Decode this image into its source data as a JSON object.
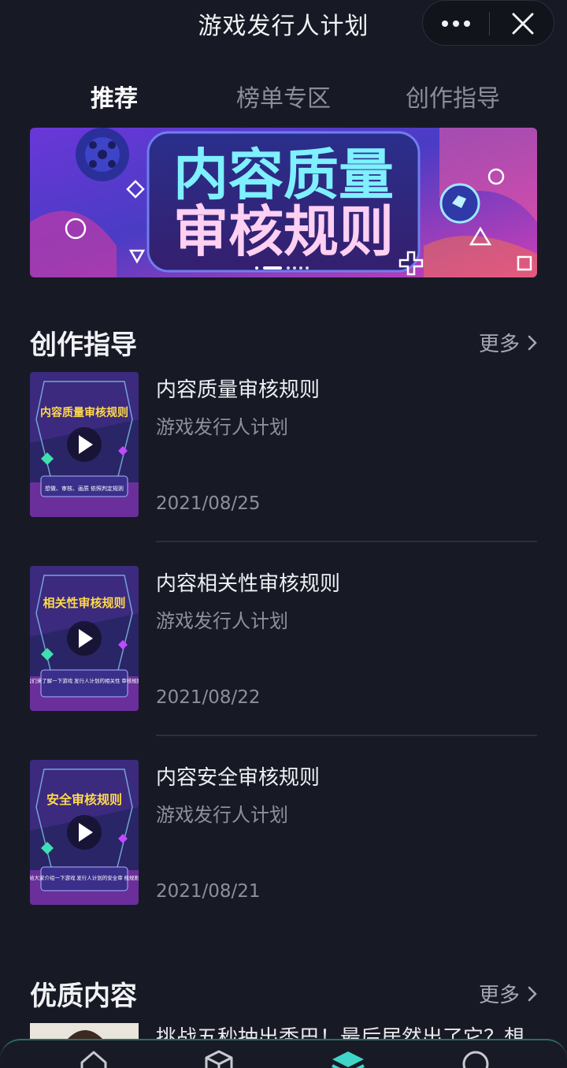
{
  "header": {
    "title": "游戏发行人计划",
    "more_icon": "more-dots-icon",
    "close_icon": "close-icon"
  },
  "tabs": [
    {
      "label": "推荐",
      "active": true
    },
    {
      "label": "榜单专区",
      "active": false
    },
    {
      "label": "创作指导",
      "active": false
    }
  ],
  "banner": {
    "line1": "内容质量",
    "line2": "审核规则",
    "slide_count": 6,
    "active_slide": 1
  },
  "guide_section": {
    "title": "创作指导",
    "more_label": "更多",
    "items": [
      {
        "title": "内容质量审核规则",
        "author": "游戏发行人计划",
        "date": "2021/08/25",
        "thumb_heading": "内容质量审核规则",
        "thumb_caption": "想做、审核、画质 依照判定规则"
      },
      {
        "title": "内容相关性审核规则",
        "author": "游戏发行人计划",
        "date": "2021/08/22",
        "thumb_heading": "相关性审核规则",
        "thumb_caption": "我们来了解一下游戏 发行人计划的相关性 审核规则"
      },
      {
        "title": "内容安全审核规则",
        "author": "游戏发行人计划",
        "date": "2021/08/21",
        "thumb_heading": "安全审核规则",
        "thumb_caption": "给大家介绍一下游戏 发行人计划的安全审 核规则"
      }
    ]
  },
  "quality_section": {
    "title": "优质内容",
    "more_label": "更多",
    "peek_title": "挑战五秒抽出秃巴！最后居然出了它？想"
  },
  "bottom_nav": {
    "icons": [
      "home-icon",
      "box-icon",
      "layers-icon",
      "search-icon"
    ],
    "active_index": 2
  },
  "colors": {
    "background": "#171a24",
    "accent": "#3fd6c9",
    "muted_text": "#8d909a"
  }
}
